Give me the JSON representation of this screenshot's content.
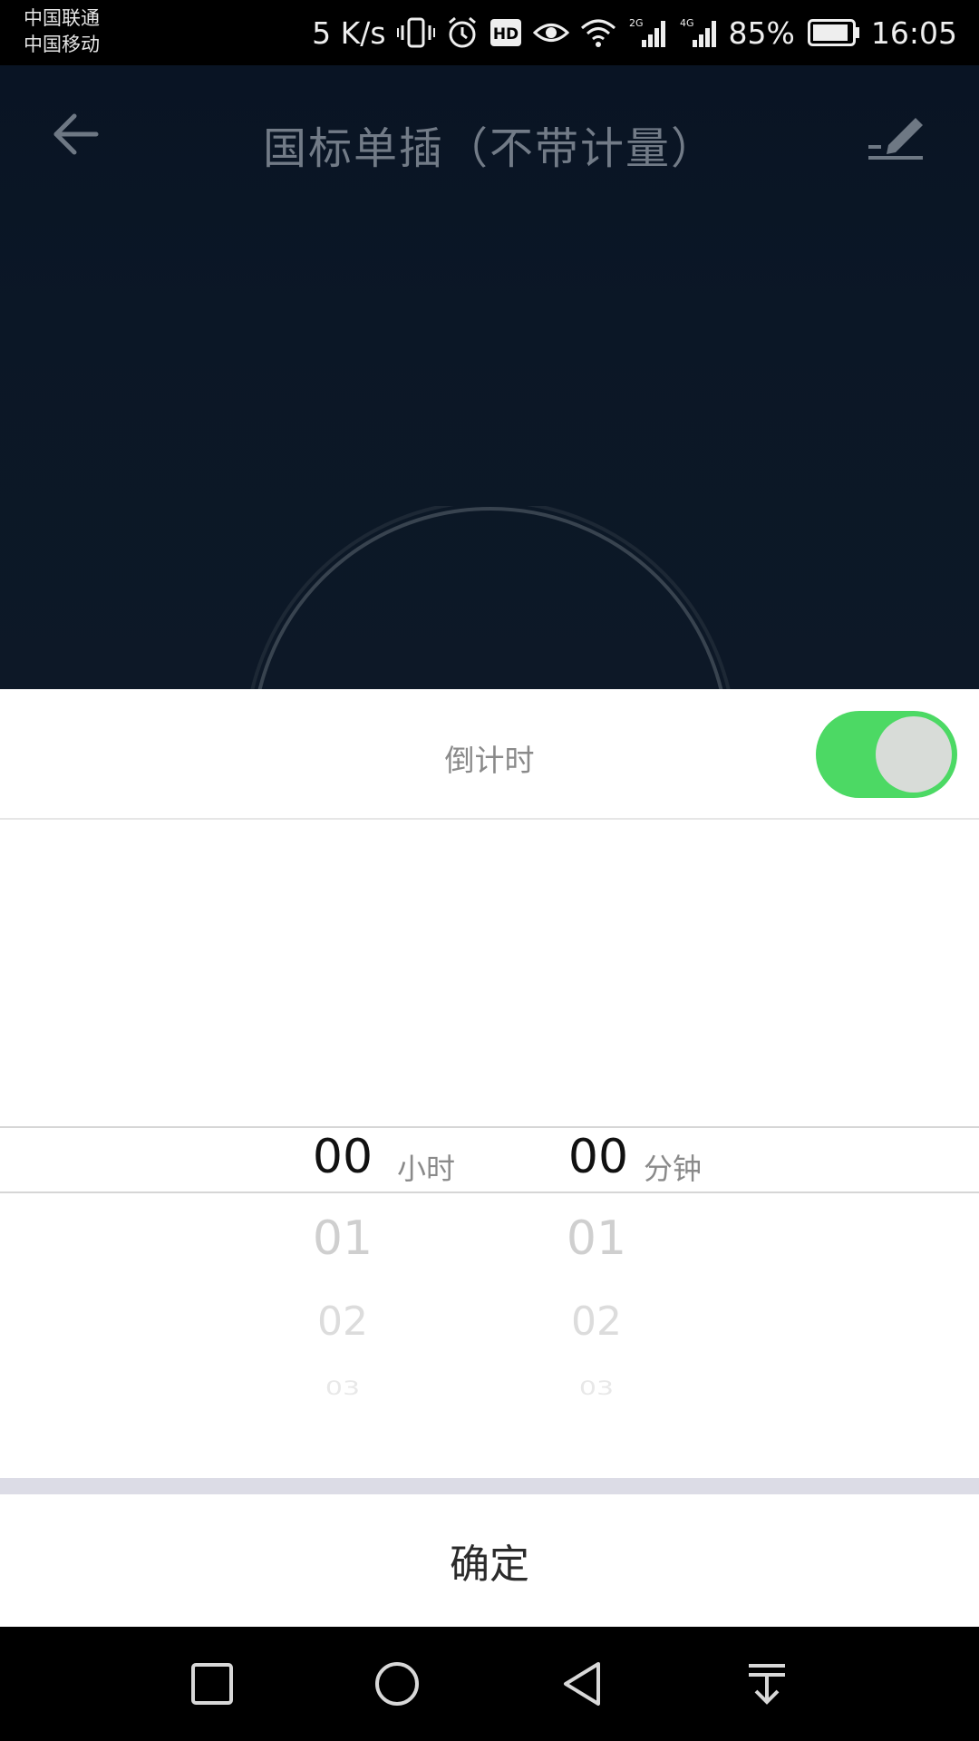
{
  "status_bar": {
    "carrier_1": "中国联通",
    "carrier_2": "中国移动",
    "network_speed": "5 K/s",
    "signal_1_label": "2G",
    "signal_2_label": "4G",
    "battery": "85%",
    "time": "16:05",
    "icons": [
      "vibrate-icon",
      "alarm-icon",
      "hd-icon",
      "eye-icon",
      "wifi-icon",
      "signal-2g-icon",
      "signal-4g-icon",
      "battery-icon"
    ]
  },
  "header": {
    "title": "国标单插（不带计量）",
    "back_icon": "back-arrow-icon",
    "edit_icon": "edit-icon"
  },
  "sheet": {
    "title": "倒计时",
    "toggle_on": true,
    "toggle_color": "#4cd964",
    "picker": {
      "hours": {
        "unit": "小时",
        "selected": "00",
        "below": [
          "01",
          "02",
          "03"
        ]
      },
      "minutes": {
        "unit": "分钟",
        "selected": "00",
        "below": [
          "01",
          "02",
          "03"
        ]
      }
    },
    "confirm_label": "确定"
  },
  "nav_bar": {
    "icons": [
      "recent-apps-icon",
      "home-icon",
      "back-icon",
      "notification-pulldown-icon"
    ]
  }
}
